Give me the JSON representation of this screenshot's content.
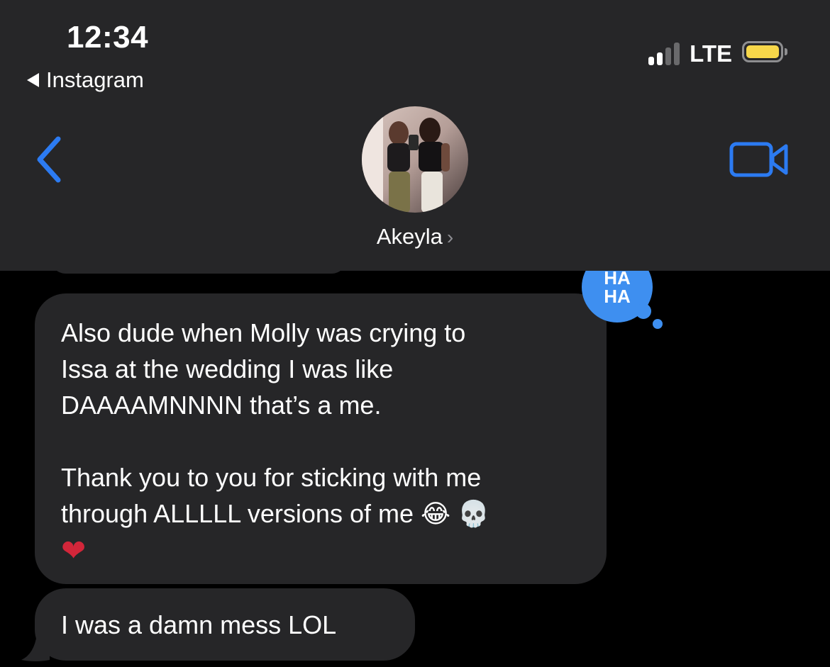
{
  "status_bar": {
    "time": "12:34",
    "back_app": "Instagram",
    "network": "LTE",
    "signal_bars": 2,
    "battery_color": "#f7d74a"
  },
  "header": {
    "contact_name": "Akeyla",
    "back_icon": "chevron-left-icon",
    "video_icon": "video-camera-icon",
    "accent_color": "#2c7bf2"
  },
  "messages": [
    {
      "lines": [
        "Also dude when Molly was crying to",
        "Issa at the wedding I was like",
        "DAAAAMNNNN that’s a me.",
        "Thank you to you for sticking with me",
        "through ALLLLL versions of me"
      ],
      "emoji": [
        "😂",
        "💀",
        "❤"
      ],
      "tapback": {
        "label_1": "HA",
        "label_2": "HA"
      }
    },
    {
      "text": "I was a damn mess LOL"
    }
  ]
}
